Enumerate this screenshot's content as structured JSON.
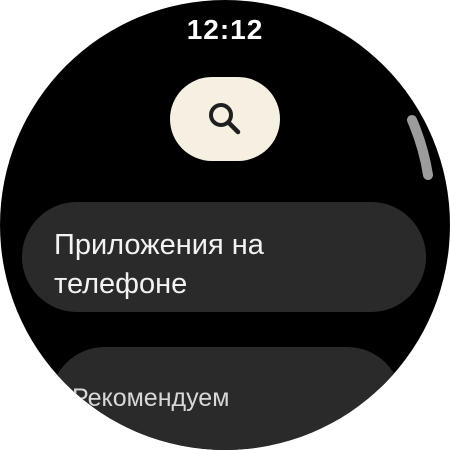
{
  "status_bar": {
    "time": "12:12"
  },
  "search": {
    "icon": "search-icon",
    "icon_color": "#1f1f1f",
    "button_color": "#f6f0e2"
  },
  "menu": {
    "items": [
      {
        "label": "Приложения на телефоне"
      },
      {
        "label": "Рекомендуем"
      }
    ]
  },
  "scroll": {
    "position_fraction": 0.15
  }
}
